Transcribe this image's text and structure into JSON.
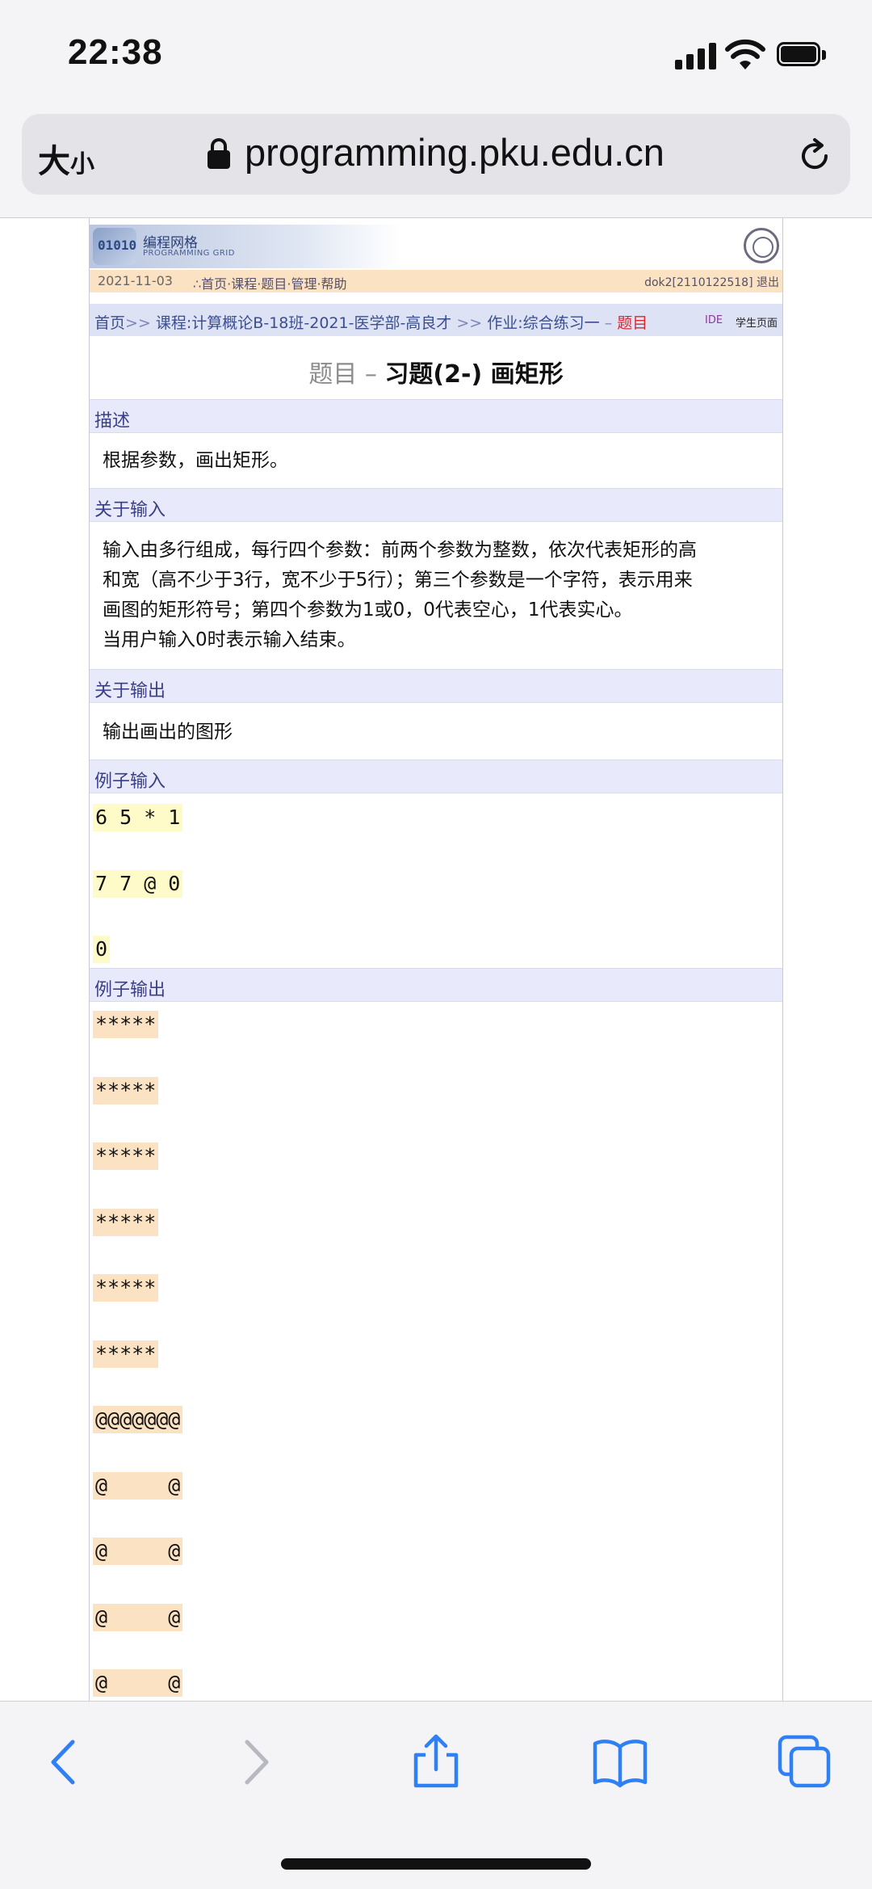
{
  "status": {
    "time": "22:38"
  },
  "browser": {
    "text_size_label": "大",
    "text_size_small": "小",
    "url": "programming.pku.edu.cn"
  },
  "site": {
    "logo_cn": "编程网格",
    "logo_en": "PROGRAMMING GRID",
    "logo_mark": "01010",
    "date": "2021-11-03",
    "nav_links": "∴首页·课程·题目·管理·帮助",
    "user": "dok2[2110122518] 退出"
  },
  "breadcrumb": {
    "home": "首页",
    "sep1": ">>",
    "course": "课程:计算概论B-18班-2021-医学部-高良才",
    "sep2": ">>",
    "assignment": "作业:综合练习一",
    "sep3": "–",
    "current": "题目",
    "ide": "IDE",
    "student_page": "学生页面"
  },
  "problem": {
    "title_prefix": "题目 –",
    "title": "习题(2-) 画矩形",
    "sections": {
      "description": "描述",
      "input": "关于输入",
      "output": "关于输出",
      "sample_input": "例子输入",
      "sample_output": "例子输出"
    },
    "description": "根据参数，画出矩形。",
    "input_desc_1": "输入由多行组成，每行四个参数：前两个参数为整数，依次代表矩形的高",
    "input_desc_2": "和宽（高不少于3行，宽不少于5行）；第三个参数是一个字符，表示用来",
    "input_desc_3": "画图的矩形符号；第四个参数为1或0，0代表空心，1代表实心。",
    "input_desc_4": "当用户输入0时表示输入结束。",
    "output_desc": "输出画出的图形",
    "sample_input": [
      "6 5 * 1",
      "7 7 @ 0",
      "0"
    ],
    "sample_output": [
      "*****",
      "*****",
      "*****",
      "*****",
      "*****",
      "*****",
      "@@@@@@@",
      "@     @",
      "@     @",
      "@     @",
      "@     @"
    ]
  }
}
